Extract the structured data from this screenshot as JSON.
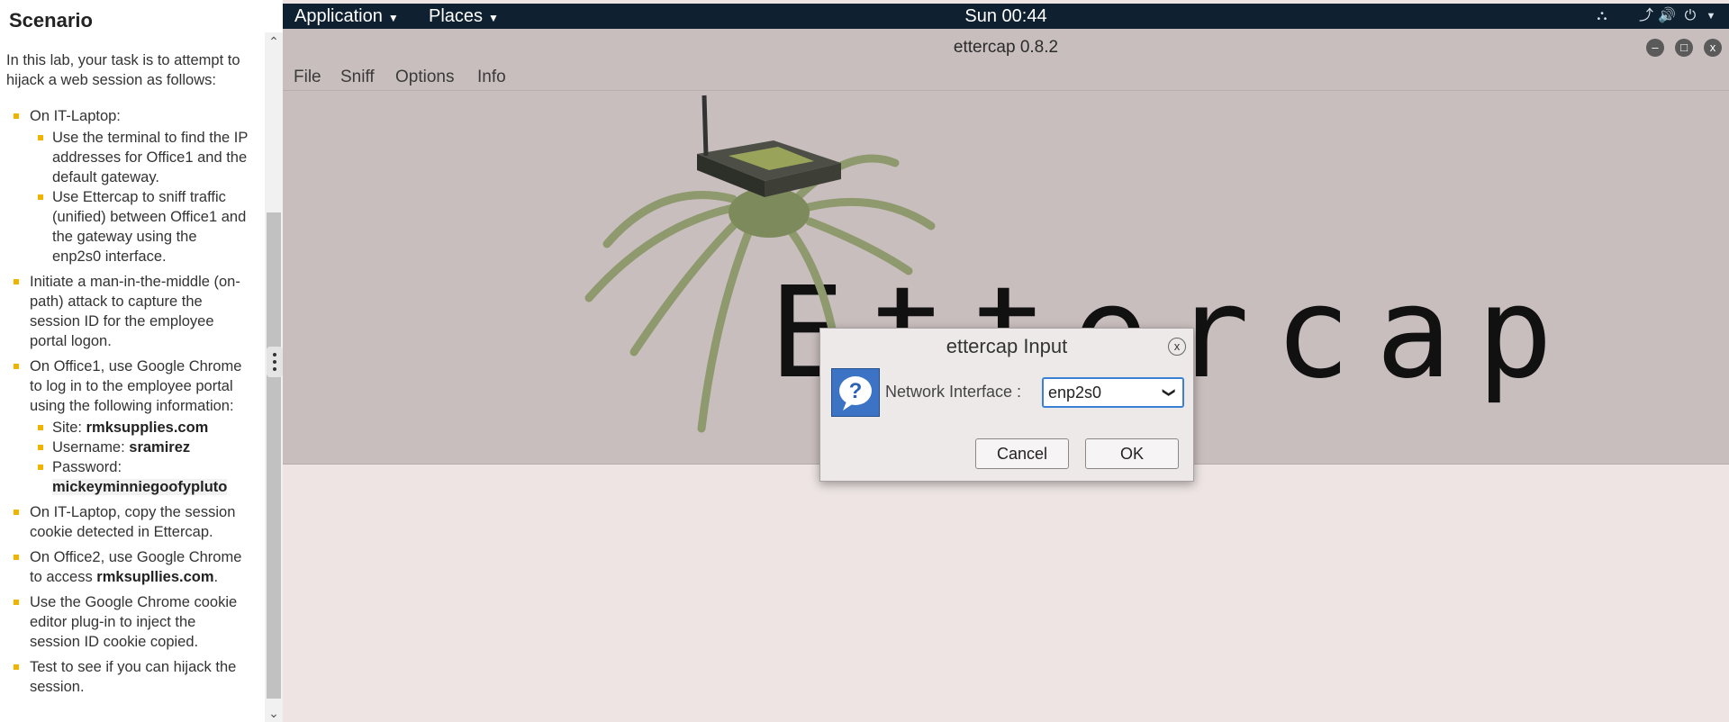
{
  "scenario": {
    "title": "Scenario",
    "intro": "In this lab, your task is to attempt to hijack a web session as follows:",
    "items": [
      {
        "text": "On IT-Laptop:",
        "subitems": [
          "Use the terminal to find the IP addresses for Office1 and the default gateway.",
          "Use Ettercap to sniff traffic (unified) between Office1 and the gateway using the enp2s0 interface."
        ]
      },
      {
        "text": "Initiate a man-in-the-middle (on-path) attack to capture the session ID for the employee portal logon."
      },
      {
        "text": "On Office1, use Google Chrome to log in to the employee portal using the following information:",
        "subitems_kv": [
          {
            "label": "Site: ",
            "value": "rmksupplies.com"
          },
          {
            "label": "Username: ",
            "value": "sramirez"
          },
          {
            "label": "Password: ",
            "value": "mickeyminniegoofypluto"
          }
        ]
      },
      {
        "text": "On IT-Laptop, copy the session cookie detected in Ettercap."
      },
      {
        "text_before": "On Office2, use Google Chrome to access ",
        "strong": "rmksupllies.com",
        "text_after": "."
      },
      {
        "text": "Use the Google Chrome cookie editor plug-in to inject the session ID cookie copied."
      },
      {
        "text": "Test to see if you can hijack the session."
      }
    ]
  },
  "topbar": {
    "applications": "Application",
    "places": "Places",
    "clock": "Sun 00:44"
  },
  "window": {
    "title": "ettercap 0.8.2",
    "menu": [
      "File",
      "Sniff",
      "Options",
      "Info"
    ],
    "logo_text": "Ettercap"
  },
  "dialog": {
    "title": "ettercap Input",
    "close": "x",
    "label": "Network Interface :",
    "interface_value": "enp2s0",
    "cancel": "Cancel",
    "ok": "OK"
  },
  "colors": {
    "accent_bullet": "#f0b400",
    "topbar_bg": "#0f2030",
    "window_bg": "#c9bebe",
    "focus_blue": "#3a80d6"
  }
}
